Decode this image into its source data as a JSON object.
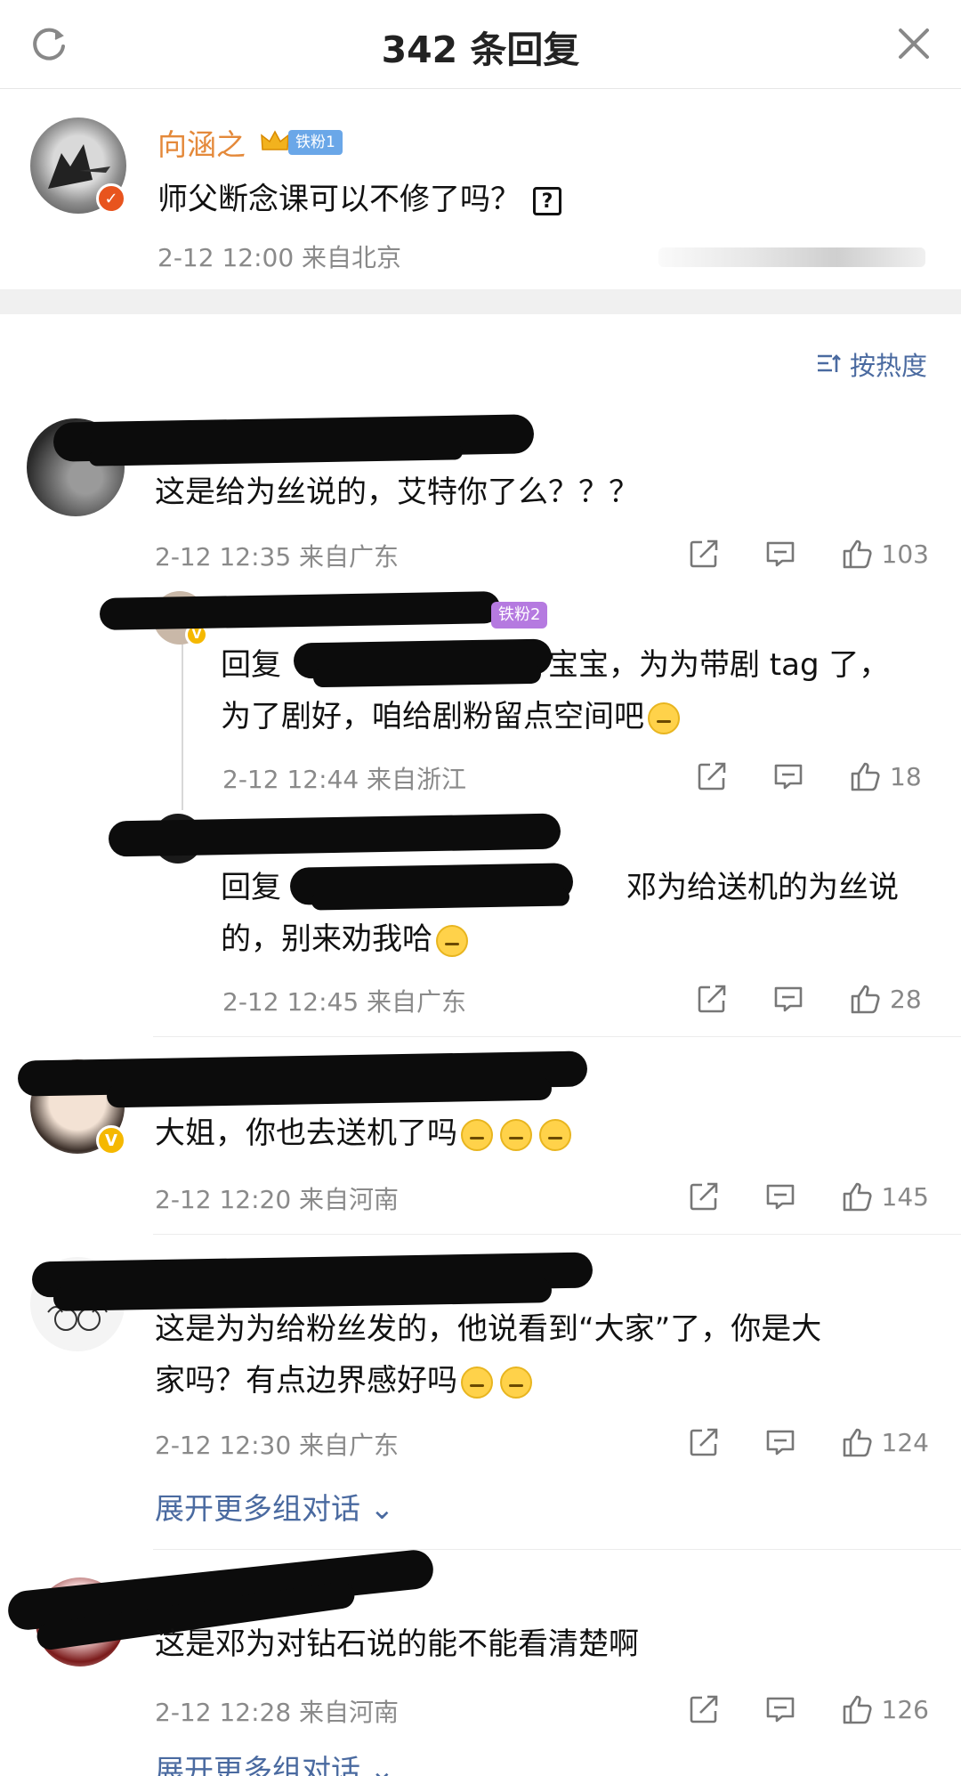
{
  "header": {
    "title": "342 条回复"
  },
  "post": {
    "author": "向涵之",
    "fan_badge": "铁粉1",
    "content": "师父断念课可以不修了吗？",
    "meta": "2-12 12:00  来自北京"
  },
  "sort_label": "按热度",
  "comments": [
    {
      "text": "这是给为丝说的，艾特你了么？？？",
      "meta": "2-12 12:35  来自广东",
      "likes": "103",
      "replies": [
        {
          "badge": "铁粉2",
          "prefix": "回复",
          "text_line1": "宝宝，为为带剧 tag 了，",
          "text_line2": "为了剧好，咱给剧粉留点空间吧",
          "meta": "2-12 12:44  来自浙江",
          "likes": "18"
        },
        {
          "prefix": "回复",
          "text_line1": "邓为给送机的为丝说",
          "text_line2": "的，别来劝我哈",
          "meta": "2-12 12:45  来自广东",
          "likes": "28"
        }
      ]
    },
    {
      "text": "大姐，你也去送机了吗",
      "meta": "2-12 12:20  来自河南",
      "likes": "145"
    },
    {
      "text_line1": "这是为为给粉丝发的，他说看到“大家”了，你是大",
      "text_line2": "家吗？有点边界感好吗",
      "meta": "2-12 12:30  来自广东",
      "likes": "124",
      "more": "展开更多组对话"
    },
    {
      "text": "这是邓为对钻石说的能不能看清楚啊",
      "meta": "2-12 12:28  来自河南",
      "likes": "126",
      "more": "展开更多组对话"
    }
  ],
  "icons": [
    "refresh-icon",
    "close-icon",
    "sort-icon",
    "share-icon",
    "comment-icon",
    "like-icon"
  ],
  "colors": {
    "link": "#4a6aa0",
    "author": "#e4893a",
    "meta": "#8a8a8a"
  }
}
